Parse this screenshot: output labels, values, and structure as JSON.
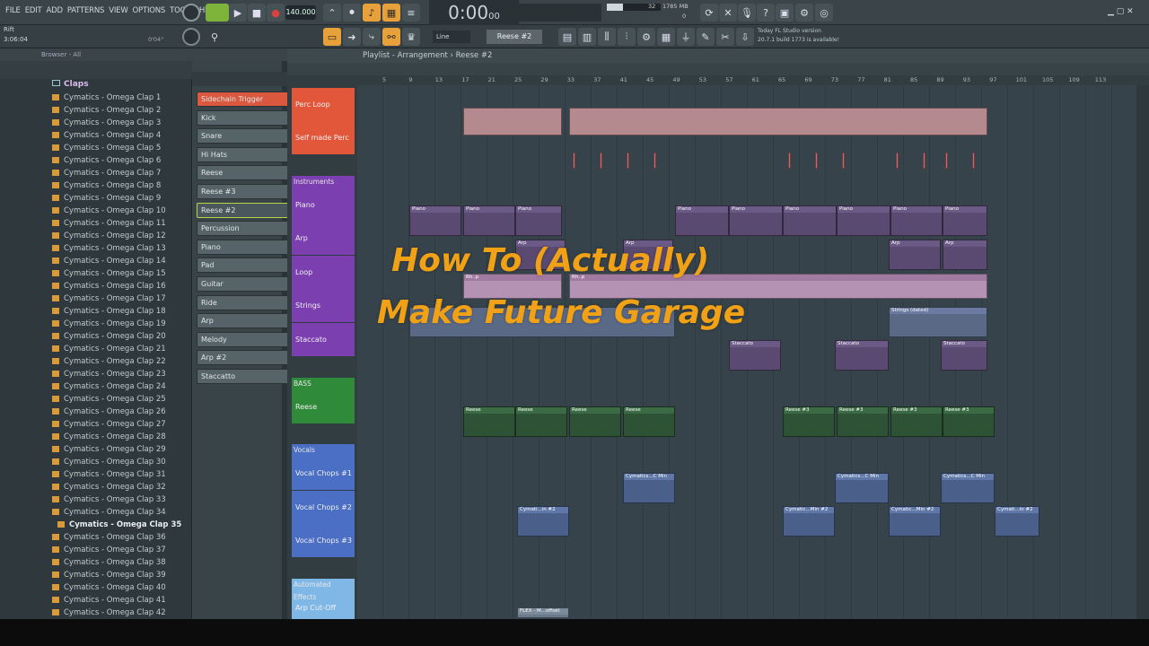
{
  "menu": [
    "FILE",
    "EDIT",
    "ADD",
    "PATTERNS",
    "VIEW",
    "OPTIONS",
    "TOOLS",
    "HELP"
  ],
  "transport": {
    "tempo": "140.000",
    "time": "0:00",
    "time_small": "00",
    "cpu": "32",
    "mem": "1785 MB",
    "voices": "0"
  },
  "toolbar2": {
    "snap": "Line",
    "pattern": "Reese #2"
  },
  "hint": {
    "line1": "Today FL Studio version",
    "line2": "20.7.1 build 1773 is available!"
  },
  "project": {
    "name": "Rift",
    "length": "3:06:04",
    "pos": "0'04\""
  },
  "browser": {
    "header": "Browser - All",
    "folder": "Claps",
    "items": [
      "Cymatics - Omega Clap 1",
      "Cymatics - Omega Clap 2",
      "Cymatics - Omega Clap 3",
      "Cymatics - Omega Clap 4",
      "Cymatics - Omega Clap 5",
      "Cymatics - Omega Clap 6",
      "Cymatics - Omega Clap 7",
      "Cymatics - Omega Clap 8",
      "Cymatics - Omega Clap 9",
      "Cymatics - Omega Clap 10",
      "Cymatics - Omega Clap 11",
      "Cymatics - Omega Clap 12",
      "Cymatics - Omega Clap 13",
      "Cymatics - Omega Clap 14",
      "Cymatics - Omega Clap 15",
      "Cymatics - Omega Clap 16",
      "Cymatics - Omega Clap 17",
      "Cymatics - Omega Clap 18",
      "Cymatics - Omega Clap 19",
      "Cymatics - Omega Clap 20",
      "Cymatics - Omega Clap 21",
      "Cymatics - Omega Clap 22",
      "Cymatics - Omega Clap 23",
      "Cymatics - Omega Clap 24",
      "Cymatics - Omega Clap 25",
      "Cymatics - Omega Clap 26",
      "Cymatics - Omega Clap 27",
      "Cymatics - Omega Clap 28",
      "Cymatics - Omega Clap 29",
      "Cymatics - Omega Clap 30",
      "Cymatics - Omega Clap 31",
      "Cymatics - Omega Clap 32",
      "Cymatics - Omega Clap 33",
      "Cymatics - Omega Clap 34",
      "Cymatics - Omega Clap 35",
      "Cymatics - Omega Clap 36",
      "Cymatics - Omega Clap 37",
      "Cymatics - Omega Clap 38",
      "Cymatics - Omega Clap 39",
      "Cymatics - Omega Clap 40",
      "Cymatics - Omega Clap 41",
      "Cymatics - Omega Clap 42"
    ]
  },
  "channels": [
    "Sidechain Trigger",
    "Kick",
    "Snare",
    "Hi Hats",
    "Reese",
    "Reese #3",
    "Reese #2",
    "Percussion",
    "Piano",
    "Pad",
    "Guitar",
    "Ride",
    "Arp",
    "Melody",
    "Arp #2",
    "Staccatto"
  ],
  "playlist": {
    "title": "Playlist - Arrangement › Reese #2",
    "ruler": [
      "5",
      "9",
      "13",
      "17",
      "21",
      "25",
      "29",
      "33",
      "37",
      "41",
      "45",
      "49",
      "53",
      "57",
      "61",
      "65",
      "69",
      "73",
      "77",
      "81",
      "85",
      "89",
      "93",
      "97",
      "101",
      "105",
      "109",
      "113"
    ],
    "tracks": [
      {
        "name": "Perc Loop",
        "group": "",
        "color": "#e2573a"
      },
      {
        "name": "Self made Perc",
        "group": "",
        "color": "#e2573a"
      },
      {
        "name": "Piano",
        "group": "Instruments",
        "color": "#7b3fb0"
      },
      {
        "name": "Arp",
        "group": "",
        "color": "#7b3fb0"
      },
      {
        "name": "Loop",
        "group": "",
        "color": "#7b3fb0"
      },
      {
        "name": "Strings",
        "group": "",
        "color": "#7b3fb0"
      },
      {
        "name": "Staccato",
        "group": "",
        "color": "#7b3fb0"
      },
      {
        "name": "Reese",
        "group": "BASS",
        "color": "#2f8a3a"
      },
      {
        "name": "Vocal Chops #1",
        "group": "Vocals",
        "color": "#4a6fc4"
      },
      {
        "name": "Vocal Chops #2",
        "group": "",
        "color": "#4a6fc4"
      },
      {
        "name": "Vocal Chops #3",
        "group": "",
        "color": "#4a6fc4"
      },
      {
        "name": "Arp Cut-Off",
        "group": "Automated Effects",
        "color": "#7fb8e6"
      }
    ],
    "clip_labels": {
      "piano": "Piano",
      "arp": "Arp",
      "loop": "Rh..p",
      "strings": "Strings (dated)",
      "staccato": "Staccato",
      "reese": "Reese",
      "reese3": "Reese #3",
      "vc1": "Cymatics...C Min",
      "vc2": "Cymati...in #2",
      "vc2b": "Cymatic...Min #2",
      "auto": "FLEX - M...offset"
    }
  },
  "overlay": {
    "line1": "How To (Actually)",
    "line2": "Make Future Garage"
  }
}
